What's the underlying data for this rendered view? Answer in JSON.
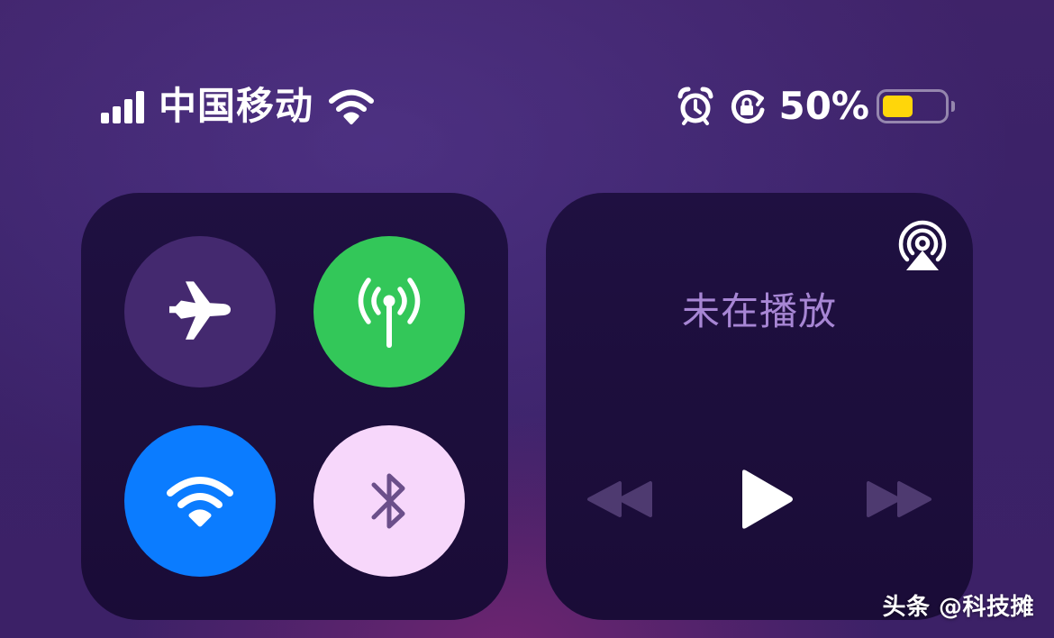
{
  "status_bar": {
    "carrier": "中国移动",
    "battery_percent": "50%",
    "battery_level": 0.5,
    "signal_bars": 4,
    "icons": [
      "cellular-signal-icon",
      "wifi-icon",
      "alarm-icon",
      "rotation-lock-icon",
      "battery-icon"
    ]
  },
  "connectivity": {
    "toggles": [
      {
        "name": "airplane-mode",
        "icon": "airplane-icon",
        "state": "off",
        "color": "#44296f"
      },
      {
        "name": "cellular-data",
        "icon": "antenna-icon",
        "state": "on",
        "color": "#33c759"
      },
      {
        "name": "wifi",
        "icon": "wifi-icon",
        "state": "on",
        "color": "#0b7cff"
      },
      {
        "name": "bluetooth",
        "icon": "bluetooth-icon",
        "state": "on",
        "color": "#f7d7fb"
      }
    ]
  },
  "now_playing": {
    "status": "未在播放",
    "airplay_icon": "airplay-audio-icon",
    "controls": [
      "rewind-icon",
      "play-icon",
      "fast-forward-icon"
    ]
  },
  "watermark": {
    "text": "头条 @科技摊"
  },
  "colors": {
    "battery_fill": "#ffd60a",
    "now_playing_text": "#a786d4",
    "background": "#3c2167"
  }
}
